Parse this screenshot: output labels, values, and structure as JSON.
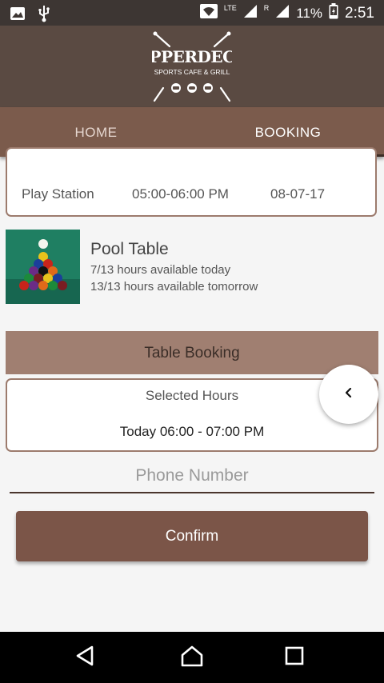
{
  "status_bar": {
    "network_type": "LTE",
    "roaming_indicator": "R",
    "battery_percent": "11%",
    "time": "2:51",
    "icons": [
      "gallery-icon",
      "usb-icon",
      "wifi-icon",
      "signal-icon",
      "battery-icon"
    ]
  },
  "header": {
    "logo_name": "UPPERDECK",
    "logo_tagline": "SPORTS CAFE & GRILL"
  },
  "tabs": [
    {
      "label": "HOME",
      "selected": false
    },
    {
      "label": "BOOKING",
      "selected": true
    }
  ],
  "booking_entry": {
    "name": "Play Station",
    "time_slot": "05:00-06:00 PM",
    "date": "08-07-17"
  },
  "pool_table": {
    "title": "Pool Table",
    "availability_today": "7/13 hours available today",
    "availability_tomorrow": "13/13 hours available tomorrow"
  },
  "table_booking": {
    "header": "Table Booking",
    "selected_hours_label": "Selected Hours",
    "selected_hours_value": "Today 06:00 - 07:00 PM"
  },
  "phone": {
    "placeholder": "Phone Number",
    "value": ""
  },
  "confirm_label": "Confirm",
  "colors": {
    "status_bar": "#3d3633",
    "header": "#5a4a42",
    "tab_bar": "#7b5b4c",
    "section_header": "#a07f71",
    "card_border": "#9c7b6d",
    "confirm_button": "#7b5548"
  }
}
